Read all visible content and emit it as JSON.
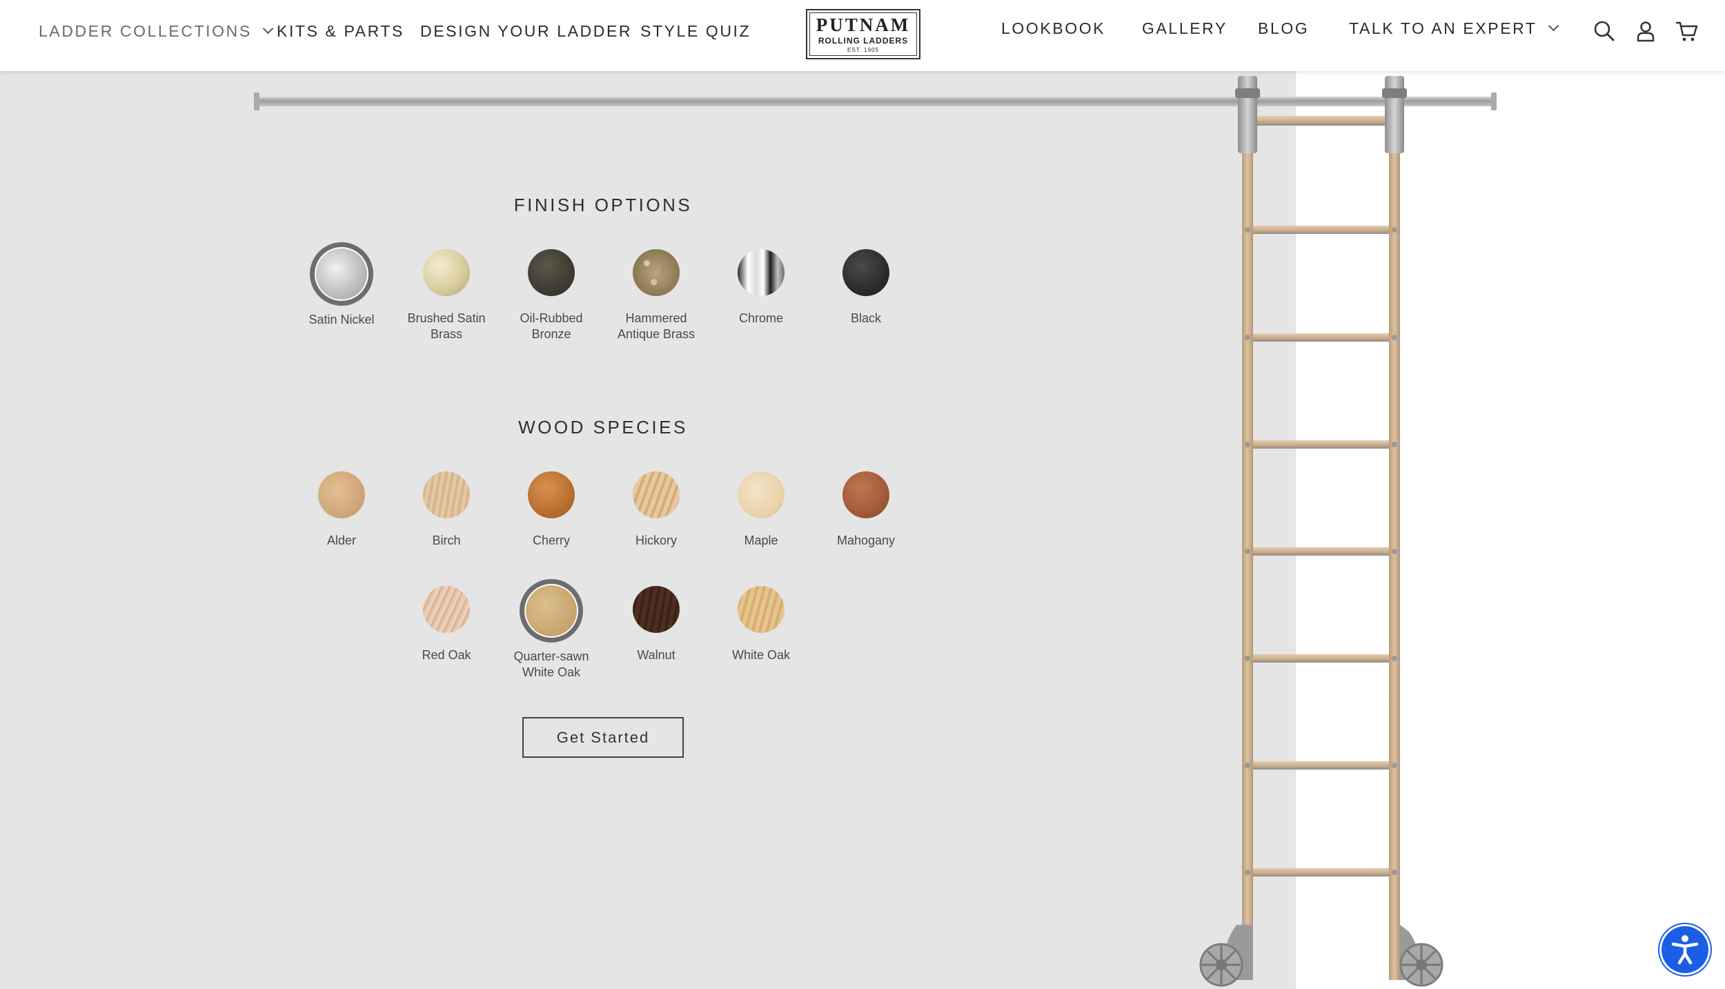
{
  "header": {
    "nav_left": [
      {
        "label": "LADDER COLLECTIONS",
        "dropdown": true
      },
      {
        "label": "KITS & PARTS"
      },
      {
        "label": "DESIGN YOUR LADDER"
      },
      {
        "label": "STYLE QUIZ"
      }
    ],
    "logo": {
      "main": "PUTNAM",
      "sub": "ROLLING LADDERS",
      "est": "EST. 1905"
    },
    "nav_right": [
      {
        "label": "LOOKBOOK"
      },
      {
        "label": "GALLERY"
      },
      {
        "label": "BLOG"
      },
      {
        "label": "TALK TO AN EXPERT",
        "dropdown": true
      }
    ],
    "icons": [
      "search-icon",
      "account-icon",
      "cart-icon"
    ]
  },
  "finish_options": {
    "title": "FINISH OPTIONS",
    "items": [
      {
        "line1": "Satin Nickel",
        "line2": "",
        "selected": true
      },
      {
        "line1": "Brushed Satin",
        "line2": "Brass",
        "selected": false
      },
      {
        "line1": "Oil-Rubbed",
        "line2": "Bronze",
        "selected": false
      },
      {
        "line1": "Hammered",
        "line2": "Antique Brass",
        "selected": false
      },
      {
        "line1": "Chrome",
        "line2": "",
        "selected": false
      },
      {
        "line1": "Black",
        "line2": "",
        "selected": false
      }
    ]
  },
  "wood_species": {
    "title": "WOOD SPECIES",
    "items": [
      {
        "line1": "Alder",
        "line2": "",
        "selected": false
      },
      {
        "line1": "Birch",
        "line2": "",
        "selected": false
      },
      {
        "line1": "Cherry",
        "line2": "",
        "selected": false
      },
      {
        "line1": "Hickory",
        "line2": "",
        "selected": false
      },
      {
        "line1": "Maple",
        "line2": "",
        "selected": false
      },
      {
        "line1": "Mahogany",
        "line2": "",
        "selected": false
      },
      {
        "line1": "Red Oak",
        "line2": "",
        "selected": false
      },
      {
        "line1": "Quarter-sawn",
        "line2": "White Oak",
        "selected": true
      },
      {
        "line1": "Walnut",
        "line2": "",
        "selected": false
      },
      {
        "line1": "White Oak",
        "line2": "",
        "selected": false
      }
    ]
  },
  "cta": {
    "label": "Get Started"
  },
  "colors": {
    "hero_background": "#e4e5e4",
    "selected_ring": "#6b6d6e",
    "accessibility_blue": "#1b5ee6",
    "ladder_wood": "#d2b594"
  }
}
